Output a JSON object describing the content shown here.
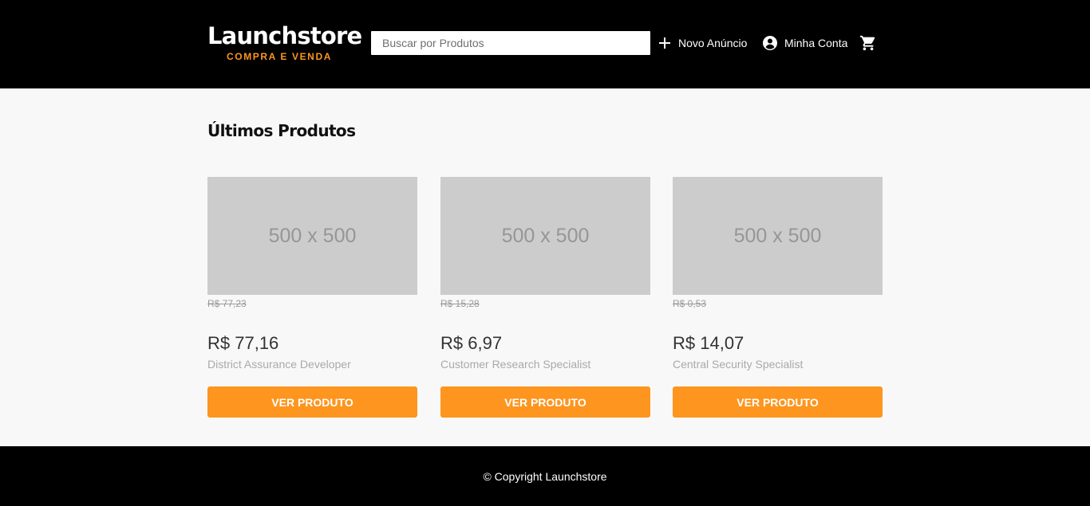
{
  "header": {
    "logo_title": "Launchstore",
    "logo_subtitle": "COMPRA E VENDA",
    "search_placeholder": "Buscar por Produtos",
    "search_icon": "none",
    "nav": {
      "new_ad_label": "Novo Anúncio",
      "new_ad_icon": "plus-icon",
      "account_label": "Minha Conta",
      "account_icon": "account-circle-icon",
      "cart_icon": "shopping-cart-icon"
    }
  },
  "main": {
    "section_title": "Últimos Produtos",
    "products": [
      {
        "image_text": "500 x 500",
        "old_price": "R$ 77,23",
        "price": "R$ 77,16",
        "name": "District Assurance Developer",
        "button_label": "VER PRODUTO"
      },
      {
        "image_text": "500 x 500",
        "old_price": "R$ 15,28",
        "price": "R$ 6,97",
        "name": "Customer Research Specialist",
        "button_label": "VER PRODUTO"
      },
      {
        "image_text": "500 x 500",
        "old_price": "R$ 0,53",
        "price": "R$ 14,07",
        "name": "Central Security Specialist",
        "button_label": "VER PRODUTO"
      }
    ]
  },
  "footer": {
    "copyright": "© Copyright Launchstore"
  },
  "colors": {
    "header_bg": "#000000",
    "accent": "#fd951f",
    "page_bg": "#f8f8f8",
    "placeholder_bg": "#cccccc"
  }
}
